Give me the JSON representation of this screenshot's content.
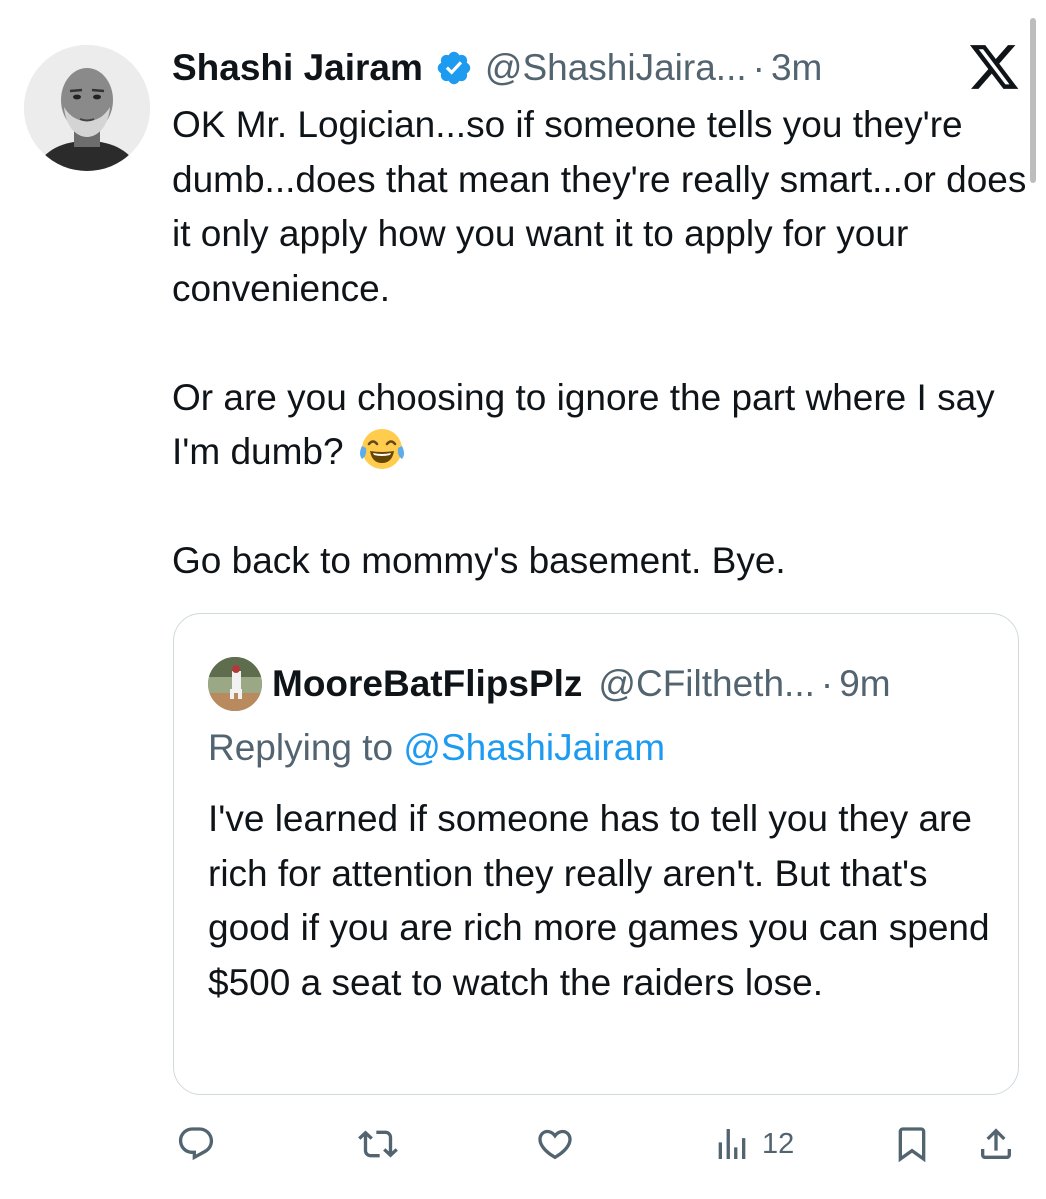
{
  "tweet": {
    "author_name": "Shashi Jairam",
    "handle": "@ShashiJaira...",
    "separator": "·",
    "time": "3m",
    "verified_icon": "verified-badge-icon",
    "platform_icon": "x-logo-icon",
    "paragraphs": [
      "OK Mr. Logician...so if someone tells you they're dumb...does that mean they're really smart...or does it only apply how you want it to apply for your convenience.",
      "Or are you choosing to ignore the part where I say I'm dumb?",
      "Go back to mommy's basement. Bye."
    ],
    "emoji": "face-with-tears-of-joy-emoji"
  },
  "quote": {
    "author_name": "MooreBatFlipsPlz",
    "handle": "@CFiltheth...",
    "separator": "·",
    "time": "9m",
    "replying_prefix": "Replying to",
    "replying_mention": "@ShashiJairam",
    "text": "I've learned if someone has to tell you they are rich for attention they really aren't. But that's good if you are rich more games you can spend $500 a seat to watch the raiders lose."
  },
  "actions": {
    "reply_icon": "reply-icon",
    "retweet_icon": "retweet-icon",
    "like_icon": "heart-icon",
    "views_icon": "views-chart-icon",
    "views_count": "12",
    "bookmark_icon": "bookmark-icon",
    "share_icon": "share-icon"
  },
  "colors": {
    "text": "#0f1419",
    "secondary": "#536471",
    "link": "#1d9bf0",
    "verified": "#1d9bf0",
    "border": "#cfd9de"
  }
}
